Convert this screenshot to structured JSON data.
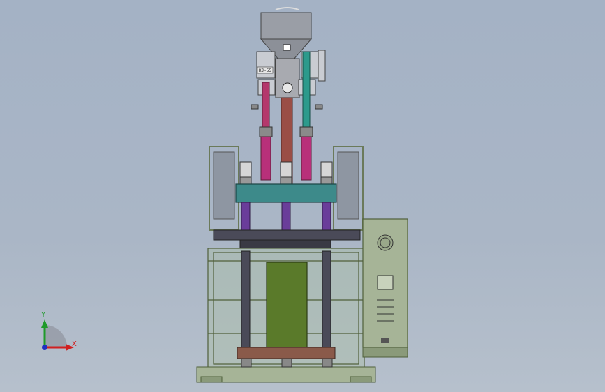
{
  "triad": {
    "x_label": "X",
    "y_label": "Y"
  },
  "machine": {
    "nameplate": "KJ-55"
  },
  "colors": {
    "background": "#a8b5c6",
    "frame": "#9fb08f",
    "rod_left": "#b4386c",
    "rod_center": "#9a4e46",
    "rod_right": "#2c9a8c",
    "columns": "#6a3d9a",
    "platen": "#3d8a8a",
    "panel": "#5a7a2a"
  },
  "icons": [
    "coordinate-triad-icon"
  ]
}
